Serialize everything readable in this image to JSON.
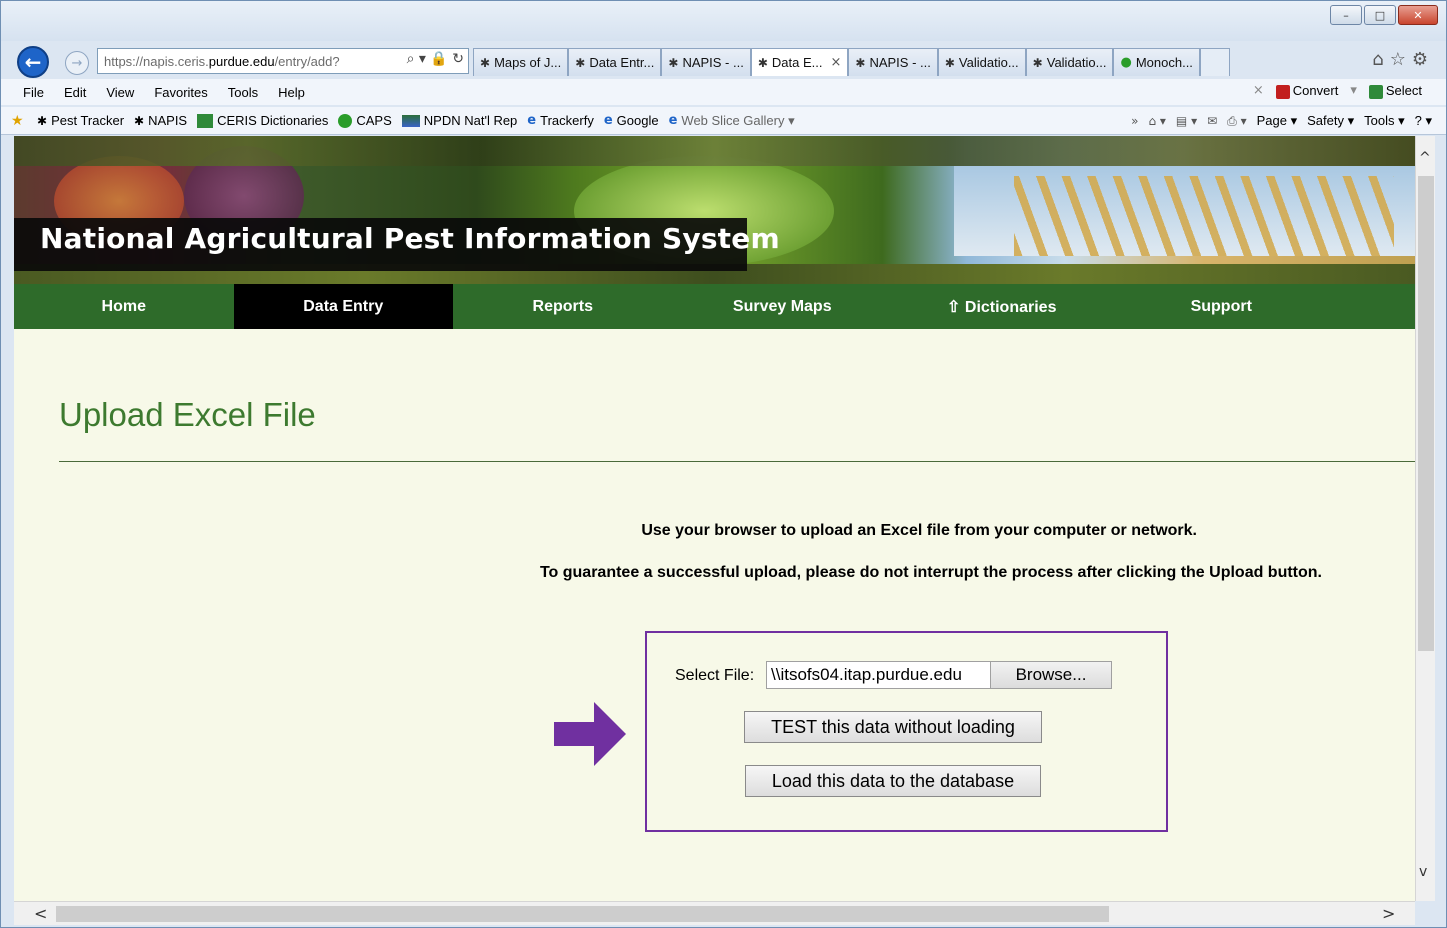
{
  "browser": {
    "address": {
      "prefix": "https://napis.ceris.",
      "domain": "purdue.edu",
      "path": "/entry/add?",
      "icons": "⌕ ▾ 🔒 ↻"
    },
    "tabs": [
      {
        "icon": "✱",
        "label": "Maps of J...",
        "active": false,
        "close": ""
      },
      {
        "icon": "✱",
        "label": "Data Entr...",
        "active": false,
        "close": ""
      },
      {
        "icon": "✱",
        "label": "NAPIS - ...",
        "active": false,
        "close": ""
      },
      {
        "icon": "✱",
        "label": "Data E...",
        "active": true,
        "close": "×"
      },
      {
        "icon": "✱",
        "label": "NAPIS - ...",
        "active": false,
        "close": ""
      },
      {
        "icon": "✱",
        "label": "Validatio...",
        "active": false,
        "close": ""
      },
      {
        "icon": "✱",
        "label": "Validatio...",
        "active": false,
        "close": ""
      },
      {
        "icon": "●",
        "label": "Monoch...",
        "active": false,
        "close": ""
      }
    ],
    "right_icons": "⌂☆⚙",
    "window_buttons": {
      "minimize": "–",
      "maximize": "□",
      "close": "✕"
    },
    "menu": [
      "File",
      "Edit",
      "View",
      "Favorites",
      "Tools",
      "Help"
    ],
    "menu_right": {
      "close": "×",
      "convert": "Convert",
      "convert_arrow": "▾",
      "select": "Select"
    },
    "favorites": [
      {
        "label": "Pest Tracker",
        "icon": "bug-icon"
      },
      {
        "label": "NAPIS",
        "icon": "bug-icon"
      },
      {
        "label": "CERIS Dictionaries",
        "icon": "ceris-icon"
      },
      {
        "label": "CAPS",
        "icon": "caps-icon"
      },
      {
        "label": "NPDN Nat'l Rep",
        "icon": "npdn-icon"
      },
      {
        "label": "Trackerfy",
        "icon": "ie-icon"
      },
      {
        "label": "Google",
        "icon": "ie-icon"
      },
      {
        "label": "Web Slice Gallery ▾",
        "icon": "ie-icon"
      }
    ],
    "cmdbar": {
      "more": "»",
      "page": "Page ▾",
      "safety": "Safety ▾",
      "tools": "Tools ▾",
      "help": "? ▾"
    }
  },
  "site": {
    "title": "National Agricultural Pest Information System",
    "nav": [
      {
        "label": "Home",
        "active": false
      },
      {
        "label": "Data Entry",
        "active": true
      },
      {
        "label": "Reports",
        "active": false
      },
      {
        "label": "Survey Maps",
        "active": false
      },
      {
        "label": "⇧ Dictionaries",
        "active": false
      },
      {
        "label": "Support",
        "active": false
      }
    ]
  },
  "page": {
    "title": "Upload Excel File",
    "instruction_1": "Use your browser to upload an Excel file from your computer or network.",
    "instruction_2": "To guarantee a successful upload, please do not interrupt the process after clicking the Upload button.",
    "select_file_label": "Select File:",
    "file_value": "\\\\itsofs04.itap.purdue.edu",
    "browse_label": "Browse...",
    "test_button": "TEST this data without loading",
    "load_button": "Load this data to the database"
  },
  "colors": {
    "nav_bg": "#2e6b2a",
    "page_bg": "#f7f9e8",
    "title_green": "#3d7a2f",
    "highlight_border": "#7030a0",
    "arrow": "#7030a0"
  },
  "scrollbars": {
    "up": "^",
    "down": "v",
    "left": "<",
    "right": ">"
  }
}
